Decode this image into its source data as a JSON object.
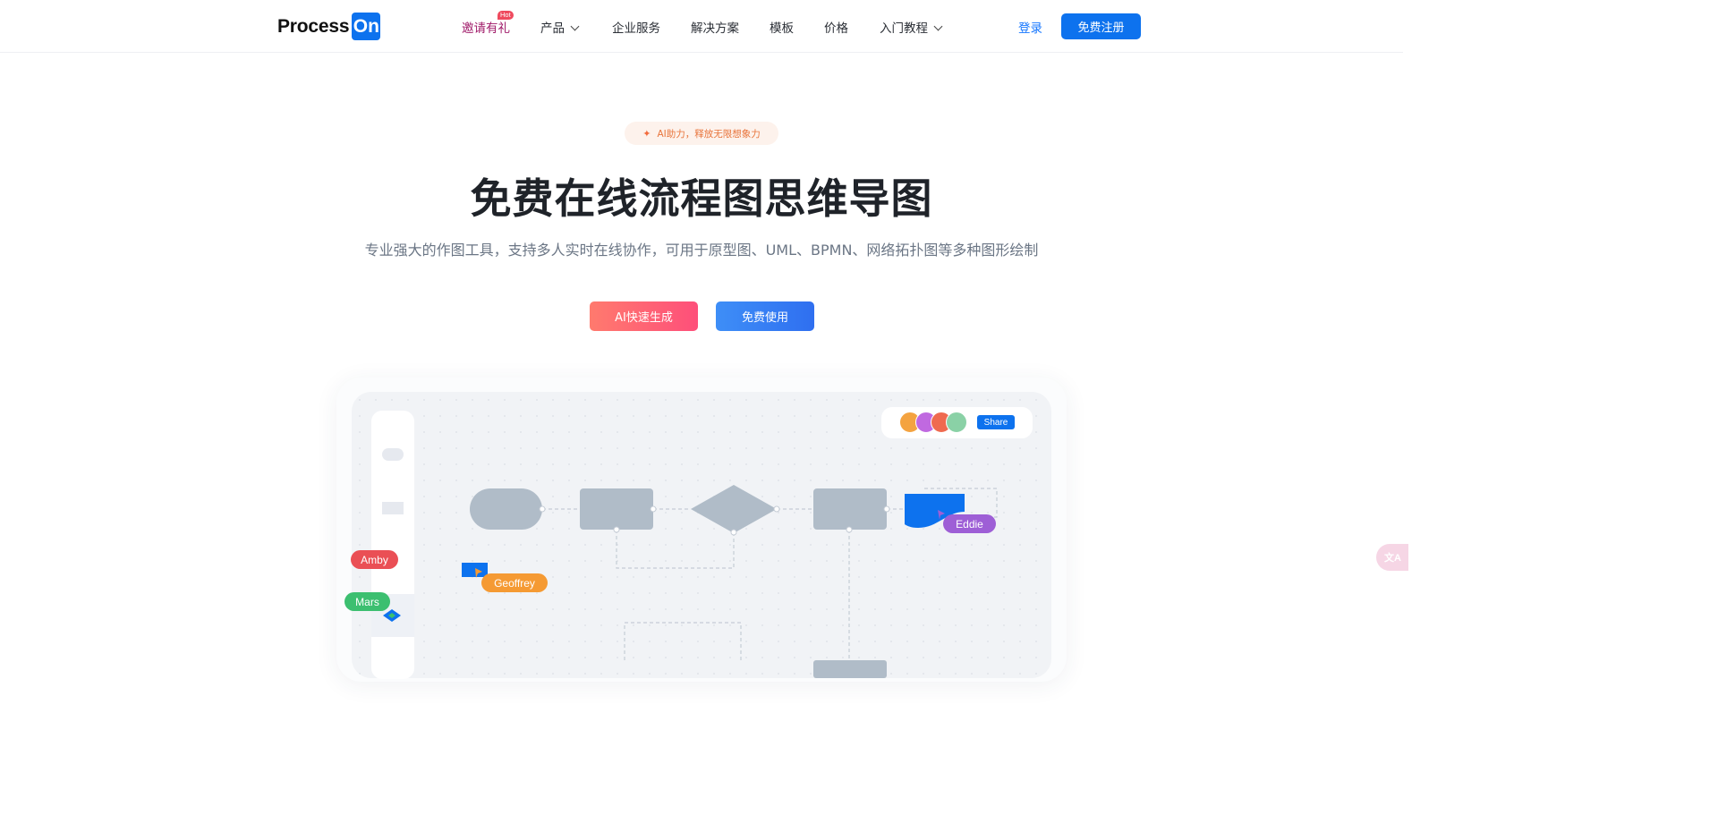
{
  "header": {
    "logo_text": "Process",
    "logo_badge": "On",
    "nav": [
      {
        "label": "邀请有礼",
        "badge": "Hot"
      },
      {
        "label": "产品"
      },
      {
        "label": "企业服务"
      },
      {
        "label": "解决方案"
      },
      {
        "label": "模板"
      },
      {
        "label": "价格"
      },
      {
        "label": "入门教程"
      }
    ],
    "login": "登录",
    "register": "免费注册"
  },
  "hero": {
    "pill": "AI助力，释放无限想象力",
    "title": "免费在线流程图思维导图",
    "subtitle": "专业强大的作图工具，支持多人实时在线协作，可用于原型图、UML、BPMN、网络拓扑图等多种图形绘制",
    "btn_ai": "AI快速生成",
    "btn_free": "免费使用"
  },
  "preview": {
    "share": "Share",
    "collaborators": [
      "Amby",
      "Mars",
      "Geoffrey",
      "Eddie"
    ]
  },
  "colors": {
    "brand": "#0d72ee",
    "invite": "#a01b6a",
    "shape": "#b0bcc8"
  }
}
